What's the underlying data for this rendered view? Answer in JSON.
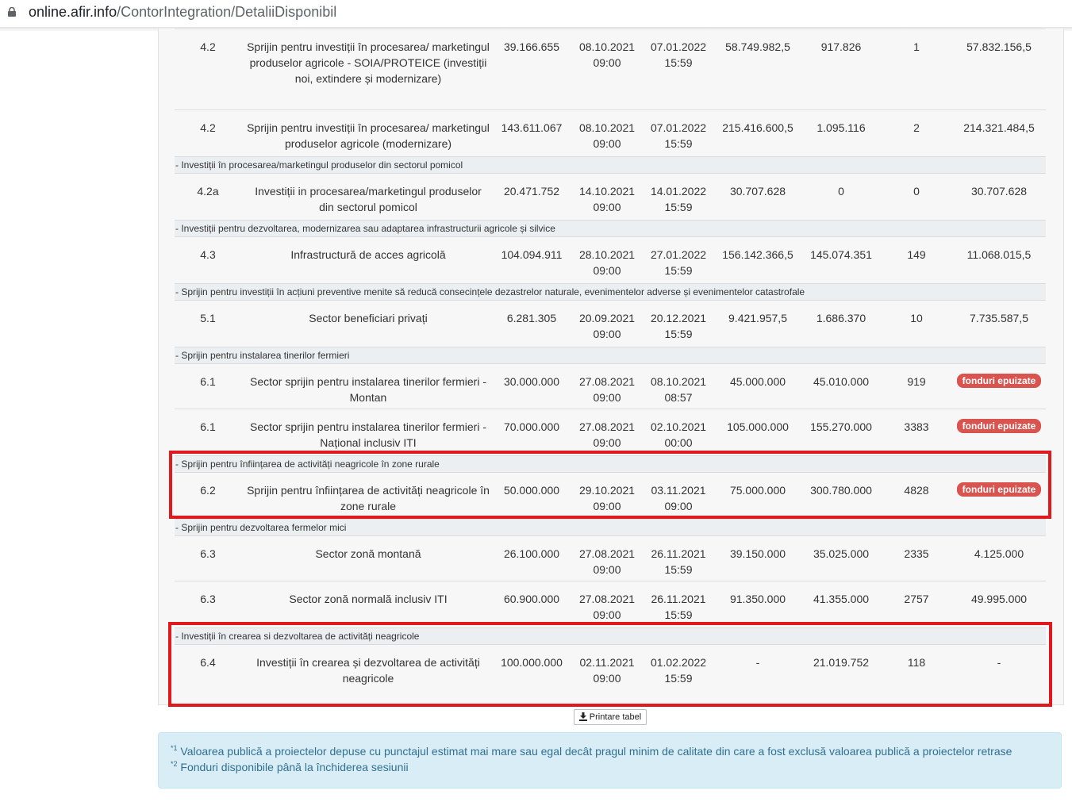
{
  "browser": {
    "url_host": "online.afir.info",
    "url_path": "/ContorIntegration/DetaliiDisponibil"
  },
  "rows_top": [
    {
      "cod": "4.2",
      "denumire": "Sprijin pentru investiții în procesarea/ marketingul produselor agricole - SOIA/PROTEICE (investiții noi, extindere și modernizare)",
      "alocare": "39.166.655",
      "start": [
        "08.10.2021",
        "09:00"
      ],
      "end": [
        "07.01.2022",
        "15:59"
      ],
      "p130": "58.749.982,5",
      "depuse": "917.826",
      "nr": "1",
      "disponibil": "57.832.156,5"
    },
    {
      "cod": "4.2",
      "denumire": "Sprijin pentru investiții în procesarea/ marketingul produselor agricole (modernizare)",
      "alocare": "143.611.067",
      "start": [
        "08.10.2021",
        "09:00"
      ],
      "end": [
        "07.01.2022",
        "15:59"
      ],
      "p130": "215.416.600,5",
      "depuse": "1.095.116",
      "nr": "2",
      "disponibil": "214.321.484,5"
    }
  ],
  "sections": {
    "s1": "- Investiții în procesarea/marketingul produselor din sectorul pomicol",
    "s2": "- Investiții pentru dezvoltarea, modernizarea sau adaptarea infrastructurii agricole și silvice",
    "s3": "- Sprijin pentru investiții în acțiuni preventive menite să reducă consecințele dezastrelor naturale, evenimentelor adverse și evenimentelor catastrofale",
    "s4": "- Sprijin pentru instalarea tinerilor fermieri",
    "s5": "- Sprijin pentru înființarea de activități neagricole în zone rurale",
    "s6": "- Sprijin pentru dezvoltarea fermelor mici",
    "s7": "- Investiții în crearea si dezvoltarea de activități neagricole"
  },
  "rows": {
    "r42a": {
      "cod": "4.2a",
      "denumire": "Investiții in procesarea/marketingul produselor din sectorul pomicol",
      "alocare": "20.471.752",
      "start": [
        "14.10.2021",
        "09:00"
      ],
      "end": [
        "14.01.2022",
        "15:59"
      ],
      "p130": "30.707.628",
      "depuse": "0",
      "nr": "0",
      "disponibil": "30.707.628"
    },
    "r43": {
      "cod": "4.3",
      "denumire": "Infrastructură de acces agricolă",
      "alocare": "104.094.911",
      "start": [
        "28.10.2021",
        "09:00"
      ],
      "end": [
        "27.01.2022",
        "15:59"
      ],
      "p130": "156.142.366,5",
      "depuse": "145.074.351",
      "nr": "149",
      "disponibil": "11.068.015,5"
    },
    "r51": {
      "cod": "5.1",
      "denumire": "Sector beneficiari privați",
      "alocare": "6.281.305",
      "start": [
        "20.09.2021",
        "09:00"
      ],
      "end": [
        "20.12.2021",
        "15:59"
      ],
      "p130": "9.421.957,5",
      "depuse": "1.686.370",
      "nr": "10",
      "disponibil": "7.735.587,5"
    },
    "r61a": {
      "cod": "6.1",
      "denumire": "Sector sprijin pentru instalarea tinerilor fermieri - Montan",
      "alocare": "30.000.000",
      "start": [
        "27.08.2021",
        "09:00"
      ],
      "end": [
        "08.10.2021",
        "08:57"
      ],
      "p130": "45.000.000",
      "depuse": "45.010.000",
      "nr": "919",
      "badge": "fonduri epuizate"
    },
    "r61b": {
      "cod": "6.1",
      "denumire": "Sector sprijin pentru instalarea tinerilor fermieri - Național inclusiv ITI",
      "alocare": "70.000.000",
      "start": [
        "27.08.2021",
        "09:00"
      ],
      "end": [
        "02.10.2021",
        "00:00"
      ],
      "p130": "105.000.000",
      "depuse": "155.270.000",
      "nr": "3383",
      "badge": "fonduri epuizate"
    },
    "r62": {
      "cod": "6.2",
      "denumire": "Sprijin pentru înființarea de activități neagricole în zone rurale",
      "alocare": "50.000.000",
      "start": [
        "29.10.2021",
        "09:00"
      ],
      "end": [
        "03.11.2021",
        "09:00"
      ],
      "p130": "75.000.000",
      "depuse": "300.780.000",
      "nr": "4828",
      "badge": "fonduri epuizate"
    },
    "r63a": {
      "cod": "6.3",
      "denumire": "Sector zonă montană",
      "alocare": "26.100.000",
      "start": [
        "27.08.2021",
        "09:00"
      ],
      "end": [
        "26.11.2021",
        "15:59"
      ],
      "p130": "39.150.000",
      "depuse": "35.025.000",
      "nr": "2335",
      "disponibil": "4.125.000"
    },
    "r63b": {
      "cod": "6.3",
      "denumire": "Sector zonă normală inclusiv ITI",
      "alocare": "60.900.000",
      "start": [
        "27.08.2021",
        "09:00"
      ],
      "end": [
        "26.11.2021",
        "15:59"
      ],
      "p130": "91.350.000",
      "depuse": "41.355.000",
      "nr": "2757",
      "disponibil": "49.995.000"
    },
    "r64": {
      "cod": "6.4",
      "denumire": "Investiții în crearea și dezvoltarea de activități neagricole",
      "alocare": "100.000.000",
      "start": [
        "02.11.2021",
        "09:00"
      ],
      "end": [
        "01.02.2022",
        "15:59"
      ],
      "p130": "-",
      "depuse": "21.019.752",
      "nr": "118",
      "disponibil": "-"
    }
  },
  "print_button": "Printare tabel",
  "notes": {
    "n1_mark": "*1",
    "n1": "Valoarea publică a proiectelor depuse cu punctajul estimat mai mare sau egal decât pragul minim de calitate din care a fost exclusă valoarea publică a proiectelor retrase",
    "n2_mark": "*2",
    "n2": "Fonduri disponibile până la închiderea sesiunii"
  },
  "colors": {
    "highlight": "#e0191f",
    "badge": "#d9534f",
    "info_bg": "#d9edf7",
    "info_text": "#31708f"
  }
}
